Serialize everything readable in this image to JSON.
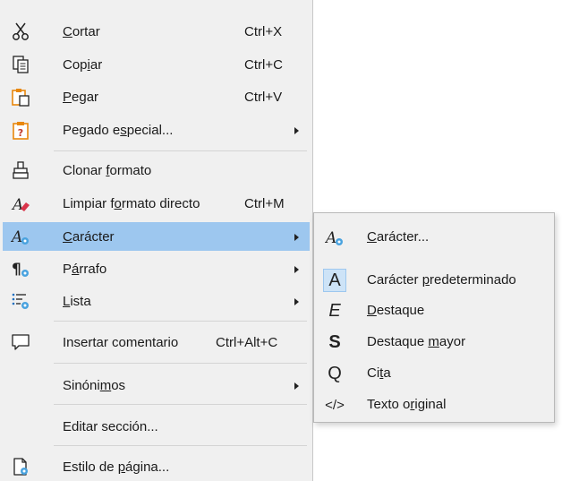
{
  "menu": {
    "items": [
      {
        "pre": "",
        "u": "C",
        "post": "ortar",
        "shortcut": "Ctrl+X",
        "icon": "scissors-icon"
      },
      {
        "pre": "Cop",
        "u": "i",
        "post": "ar",
        "shortcut": "Ctrl+C",
        "icon": "copy-icon"
      },
      {
        "pre": "",
        "u": "P",
        "post": "egar",
        "shortcut": "Ctrl+V",
        "icon": "paste-icon"
      },
      {
        "pre": "Pegado e",
        "u": "s",
        "post": "pecial...",
        "shortcut": "",
        "icon": "paste-special-icon"
      },
      {
        "pre": "Clonar ",
        "u": "f",
        "post": "ormato",
        "shortcut": "",
        "icon": "clone-format-icon"
      },
      {
        "pre": "Limpiar f",
        "u": "o",
        "post": "rmato directo",
        "shortcut": "Ctrl+M",
        "icon": "clear-format-icon"
      },
      {
        "pre": "",
        "u": "C",
        "post": "arácter",
        "shortcut": "",
        "icon": "character-style-icon"
      },
      {
        "pre": "P",
        "u": "á",
        "post": "rrafo",
        "shortcut": "",
        "icon": "paragraph-style-icon"
      },
      {
        "pre": "",
        "u": "L",
        "post": "ista",
        "shortcut": "",
        "icon": "list-style-icon"
      },
      {
        "pre": "Insertar comentario",
        "u": "",
        "post": "",
        "shortcut": "Ctrl+Alt+C",
        "icon": "comment-icon"
      },
      {
        "pre": "Sinóni",
        "u": "m",
        "post": "os",
        "shortcut": "",
        "icon": ""
      },
      {
        "pre": "Editar sección...",
        "u": "",
        "post": "",
        "shortcut": "",
        "icon": ""
      },
      {
        "pre": "Estilo de ",
        "u": "p",
        "post": "ágina...",
        "shortcut": "",
        "icon": "page-style-icon"
      }
    ]
  },
  "submenu": {
    "items": [
      {
        "pre": "",
        "u": "C",
        "post": "arácter...",
        "glyph": "",
        "icon": "character-style-icon"
      },
      {
        "pre": "Carácter ",
        "u": "p",
        "post": "redeterminado",
        "glyph": "A",
        "icon": "default-character-icon"
      },
      {
        "pre": "",
        "u": "D",
        "post": "estaque",
        "glyph": "E",
        "icon": "emphasis-icon"
      },
      {
        "pre": "Destaque ",
        "u": "m",
        "post": "ayor",
        "glyph": "S",
        "icon": "strong-emphasis-icon"
      },
      {
        "pre": "Ci",
        "u": "t",
        "post": "a",
        "glyph": "Q",
        "icon": "quotation-icon"
      },
      {
        "pre": "Texto o",
        "u": "r",
        "post": "iginal",
        "glyph": "</>",
        "icon": "source-text-icon"
      }
    ]
  },
  "colors": {
    "menu_bg": "#f0f0f0",
    "highlight": "#9dc7ef",
    "accent_orange": "#e8870c",
    "accent_blue": "#1e6fbf"
  }
}
